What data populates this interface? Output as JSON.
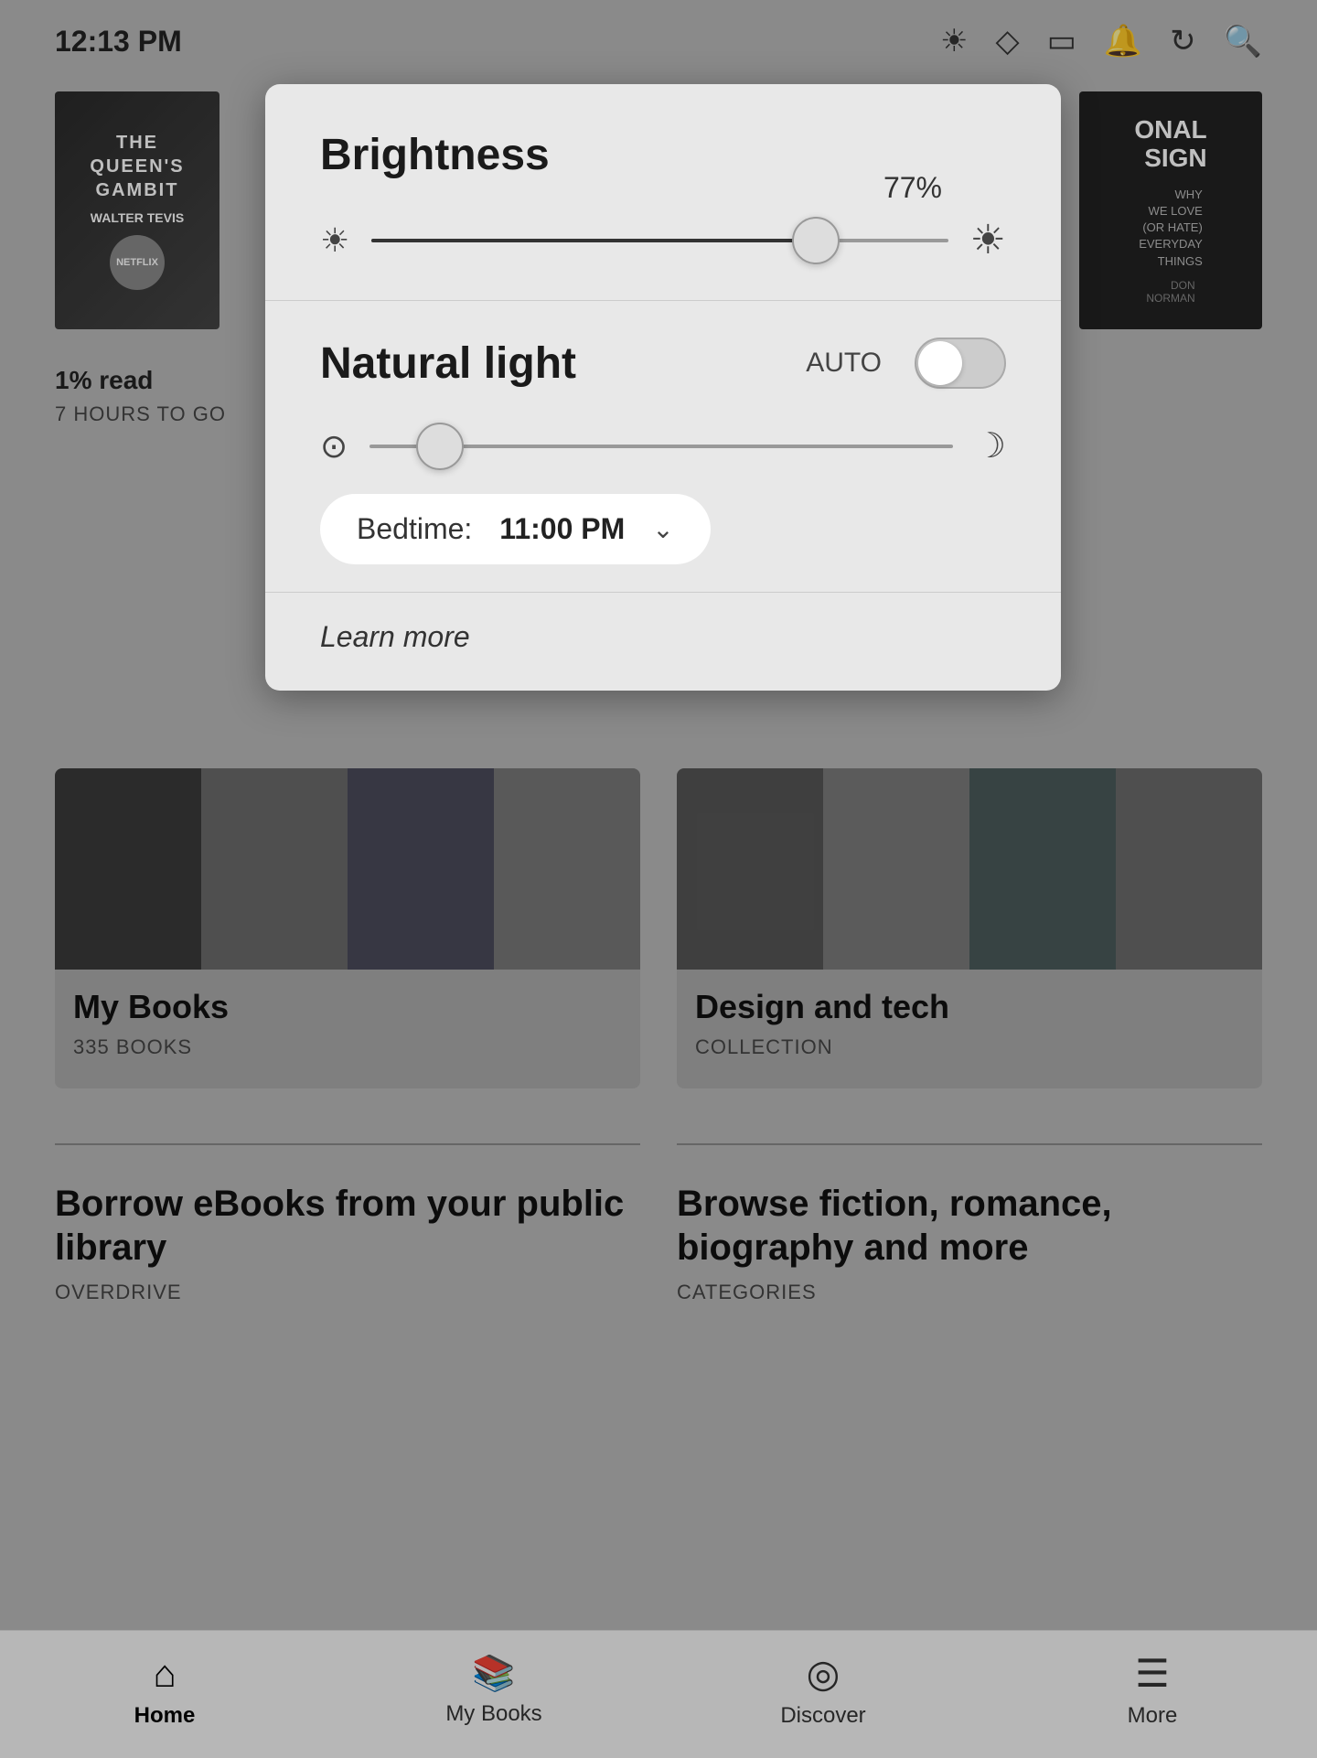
{
  "statusBar": {
    "time": "12:13 PM"
  },
  "panel": {
    "brightness": {
      "title": "Brightness",
      "percentage": "77%",
      "sliderValue": 77
    },
    "naturalLight": {
      "title": "Natural light",
      "autoLabel": "AUTO",
      "toggleEnabled": false,
      "sliderValue": 8
    },
    "bedtime": {
      "label": "Bedtime:",
      "time": "11:00 PM"
    },
    "learnMore": "Learn more"
  },
  "books": [
    {
      "title": "1% read",
      "subtitle": "7 HOURS TO GO",
      "coverTitle": "THE QUEEN'S GAMBIT",
      "coverAuthor": "WALTER TEVIS"
    },
    {
      "title": "",
      "subtitle": "",
      "coverTitle": "ONAL SIGN",
      "coverSubtitle": "WHY WE LOVE (OR HATE) EVERYDAY THINGS"
    }
  ],
  "collections": [
    {
      "title": "My Books",
      "meta": "335 BOOKS"
    },
    {
      "title": "Design and tech",
      "meta": "COLLECTION"
    }
  ],
  "links": [
    {
      "title": "Borrow eBooks from your public library",
      "meta": "OVERDRIVE"
    },
    {
      "title": "Browse fiction, romance, biography and more",
      "meta": "CATEGORIES"
    }
  ],
  "bottomNav": [
    {
      "label": "Home",
      "icon": "⌂",
      "active": true
    },
    {
      "label": "My Books",
      "icon": "📚",
      "active": false
    },
    {
      "label": "Discover",
      "icon": "◎",
      "active": false
    },
    {
      "label": "More",
      "icon": "≡",
      "active": false
    }
  ]
}
